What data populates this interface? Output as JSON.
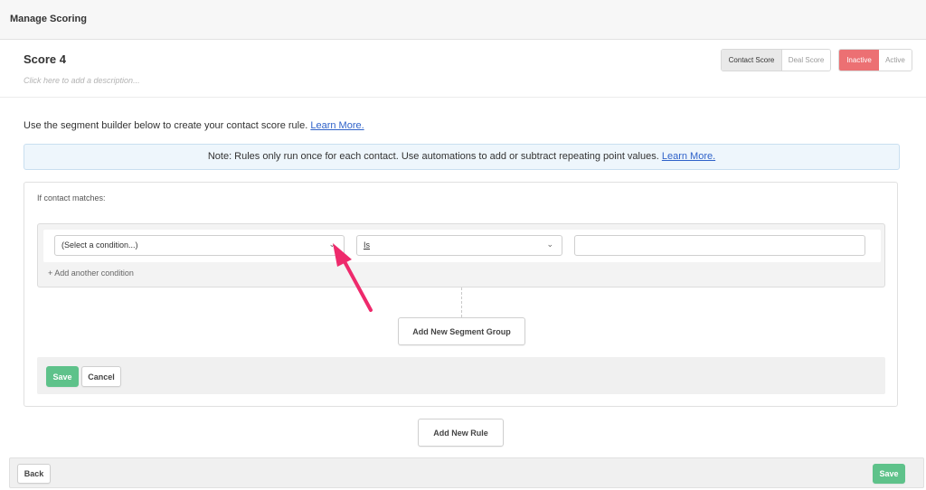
{
  "header": {
    "title": "Manage Scoring"
  },
  "score": {
    "name": "Score 4",
    "description_placeholder": "Click here to add a description...",
    "type_toggle": {
      "selected": "Contact Score",
      "other": "Deal Score"
    },
    "status_toggle": {
      "selected": "Inactive",
      "other": "Active"
    }
  },
  "intro": {
    "text": "Use the segment builder below to create your contact score rule. ",
    "link": "Learn More."
  },
  "note": {
    "text": "Note: Rules only run once for each contact. Use automations to add or subtract repeating point values. ",
    "link": "Learn More."
  },
  "rule": {
    "match_label": "If contact matches:",
    "condition": {
      "field_value": "(Select a condition...)",
      "operator_value": "Is",
      "value_input": ""
    },
    "add_condition_label": "+ Add another condition",
    "add_segment_group_label": "Add New Segment Group",
    "save_label": "Save",
    "cancel_label": "Cancel"
  },
  "add_rule_label": "Add New Rule",
  "footer": {
    "back_label": "Back",
    "save_label": "Save"
  },
  "colors": {
    "inactive": "#ec7073",
    "save_green": "#5ec28a",
    "link": "#2f62c9",
    "note_bg": "#eef6fc",
    "arrow": "#ee2a6c"
  },
  "icons": {
    "dropdown": "chevron-down-icon",
    "annotation": "pink-arrow"
  }
}
